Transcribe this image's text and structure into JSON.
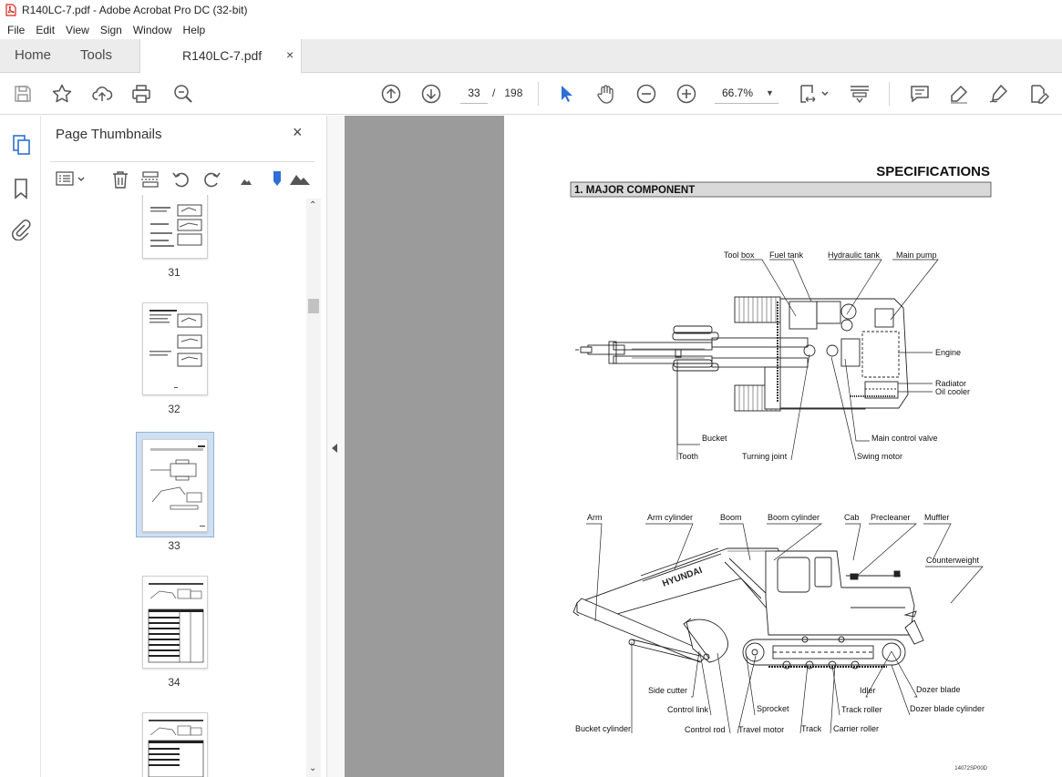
{
  "window": {
    "title": "R140LC-7.pdf - Adobe Acrobat Pro DC (32-bit)"
  },
  "menu": [
    "File",
    "Edit",
    "View",
    "Sign",
    "Window",
    "Help"
  ],
  "tabs": {
    "home": "Home",
    "tools": "Tools",
    "document": "R140LC-7.pdf",
    "close": "×"
  },
  "toolbar": {
    "page_current": "33",
    "page_sep": "/",
    "page_total": "198",
    "zoom": "66.7%"
  },
  "panel": {
    "title": "Page Thumbnails",
    "close": "×",
    "thumbnails": [
      {
        "num": "31"
      },
      {
        "num": "32"
      },
      {
        "num": "33",
        "selected": true
      },
      {
        "num": "34"
      },
      {
        "num": ""
      }
    ]
  },
  "document": {
    "heading": "SPECIFICATIONS",
    "section": "1. MAJOR COMPONENT",
    "top_view_labels": {
      "tool_box": "Tool box",
      "fuel_tank": "Fuel tank",
      "hydraulic_tank": "Hydraulic tank",
      "main_pump": "Main pump",
      "engine": "Engine",
      "radiator": "Radiator",
      "oil_cooler": "Oil cooler",
      "bucket": "Bucket",
      "main_control_valve": "Main control valve",
      "tooth": "Tooth",
      "turning_joint": "Turning joint",
      "swing_motor": "Swing motor"
    },
    "side_view_labels": {
      "arm": "Arm",
      "arm_cylinder": "Arm cylinder",
      "boom": "Boom",
      "boom_cylinder": "Boom cylinder",
      "cab": "Cab",
      "precleaner": "Precleaner",
      "muffler": "Muffler",
      "counterweight": "Counterweight",
      "side_cutter": "Side cutter",
      "idler": "Idler",
      "dozer_blade": "Dozer blade",
      "control_link": "Control link",
      "sprocket": "Sprocket",
      "track_roller": "Track roller",
      "dozer_blade_cylinder": "Dozer blade cylinder",
      "bucket_cylinder": "Bucket cylinder",
      "control_rod": "Control rod",
      "travel_motor": "Travel motor",
      "track": "Track",
      "carrier_roller": "Carrier roller"
    },
    "machine_brand": "HYUNDAI",
    "figure_code": "14072SP00D"
  },
  "colors": {
    "accent": "#2d6fd6",
    "canvas": "#9b9b9b",
    "tabbar": "#ececec",
    "pdf_red": "#d8261e"
  }
}
